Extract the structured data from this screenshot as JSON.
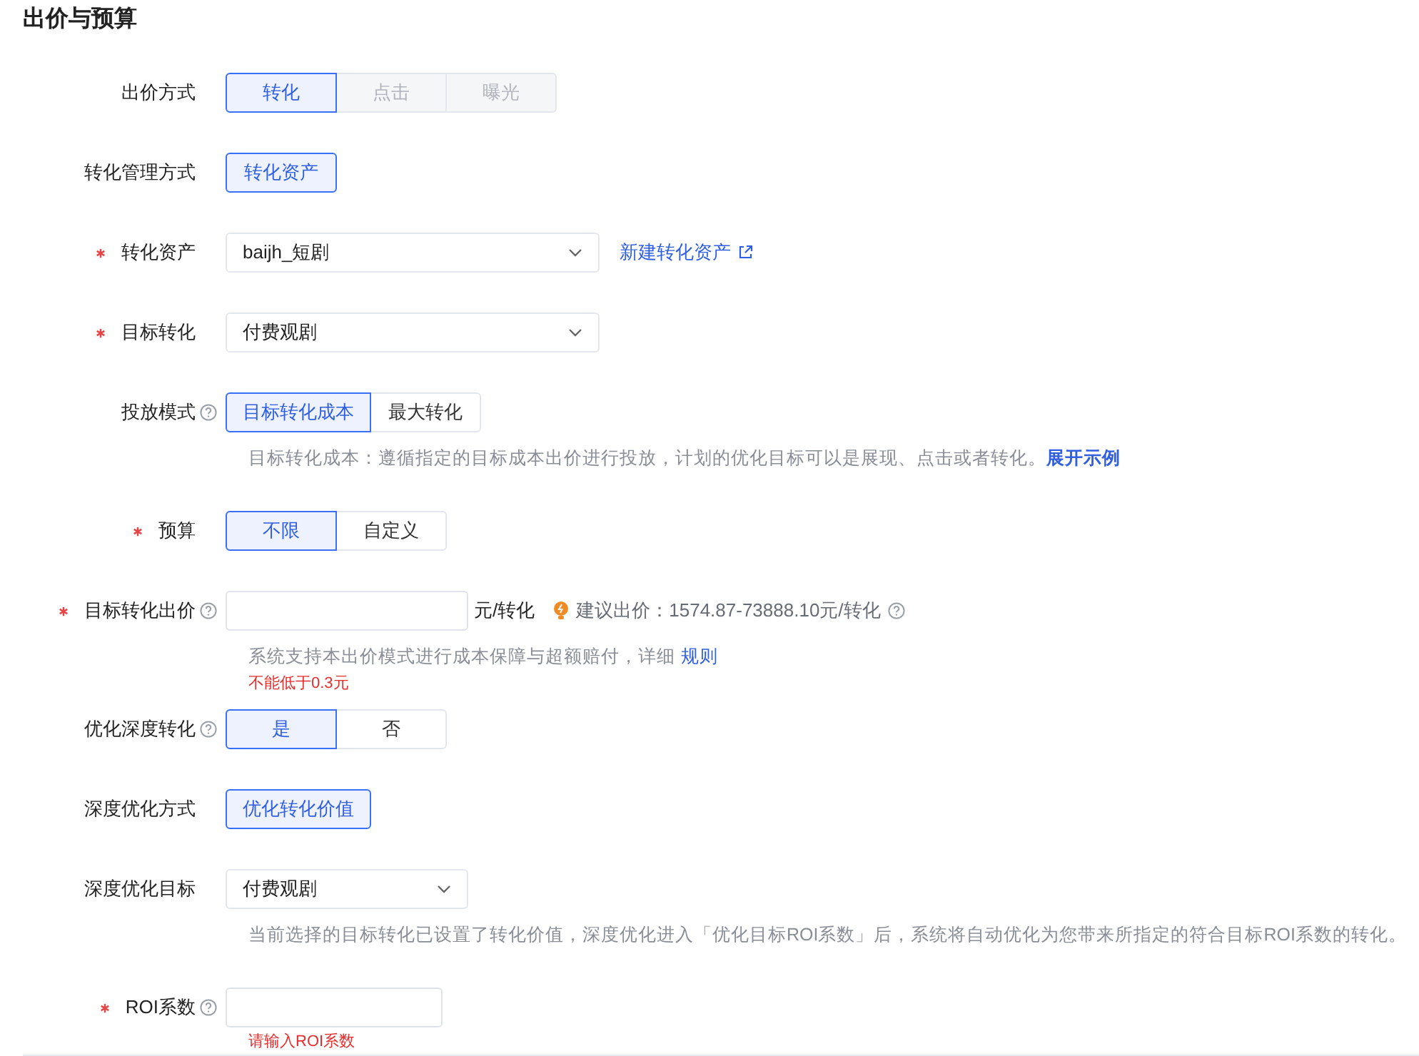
{
  "section_title": "出价与预算",
  "fields": [
    {
      "kind": "segmented",
      "label": "出价方式",
      "required": false,
      "help": false,
      "options": [
        {
          "label": "转化",
          "selected": true,
          "disabled": false
        },
        {
          "label": "点击",
          "selected": false,
          "disabled": true
        },
        {
          "label": "曝光",
          "selected": false,
          "disabled": true
        }
      ]
    },
    {
      "kind": "segmented",
      "label": "转化管理方式",
      "required": false,
      "help": false,
      "options": [
        {
          "label": "转化资产",
          "selected": true,
          "disabled": false
        }
      ]
    },
    {
      "kind": "select",
      "label": "转化资产",
      "required": true,
      "help": false,
      "value": "baijh_短剧",
      "link": "新建转化资产"
    },
    {
      "kind": "select",
      "label": "目标转化",
      "required": true,
      "help": false,
      "value": "付费观剧"
    },
    {
      "kind": "segmented",
      "label": "投放模式",
      "required": false,
      "help": true,
      "options": [
        {
          "label": "目标转化成本",
          "selected": true,
          "disabled": false
        },
        {
          "label": "最大转化",
          "selected": false,
          "disabled": false
        }
      ],
      "hint": "目标转化成本：遵循指定的目标成本出价进行投放，计划的优化目标可以是展现、点击或者转化。",
      "hint_link": "展开示例"
    },
    {
      "kind": "segmented",
      "label": "预算",
      "required": true,
      "help": false,
      "options": [
        {
          "label": "不限",
          "selected": true,
          "disabled": false
        },
        {
          "label": "自定义",
          "selected": false,
          "disabled": false
        }
      ]
    },
    {
      "kind": "input",
      "label": "目标转化出价",
      "required": true,
      "help": true,
      "suffix": "元/转化",
      "suggestion": "建议出价：1574.87-73888.10元/转化",
      "hint": "系统支持本出价模式进行成本保障与超额赔付，详细",
      "hint_link": "规则",
      "error": "不能低于0.3元"
    },
    {
      "kind": "segmented",
      "label": "优化深度转化",
      "required": false,
      "help": true,
      "options": [
        {
          "label": "是",
          "selected": true,
          "disabled": false
        },
        {
          "label": "否",
          "selected": false,
          "disabled": false
        }
      ]
    },
    {
      "kind": "segmented",
      "label": "深度优化方式",
      "required": false,
      "help": false,
      "options": [
        {
          "label": "优化转化价值",
          "selected": true,
          "disabled": false
        }
      ]
    },
    {
      "kind": "select",
      "label": "深度优化目标",
      "required": false,
      "help": false,
      "value": "付费观剧",
      "hint": "当前选择的目标转化已设置了转化价值，深度优化进入「优化目标ROI系数」后，系统将自动优化为您带来所指定的符合目标ROI系数的转化。"
    },
    {
      "kind": "input",
      "label": "ROI系数",
      "required": true,
      "help": true,
      "error": "请输入ROI系数"
    }
  ]
}
